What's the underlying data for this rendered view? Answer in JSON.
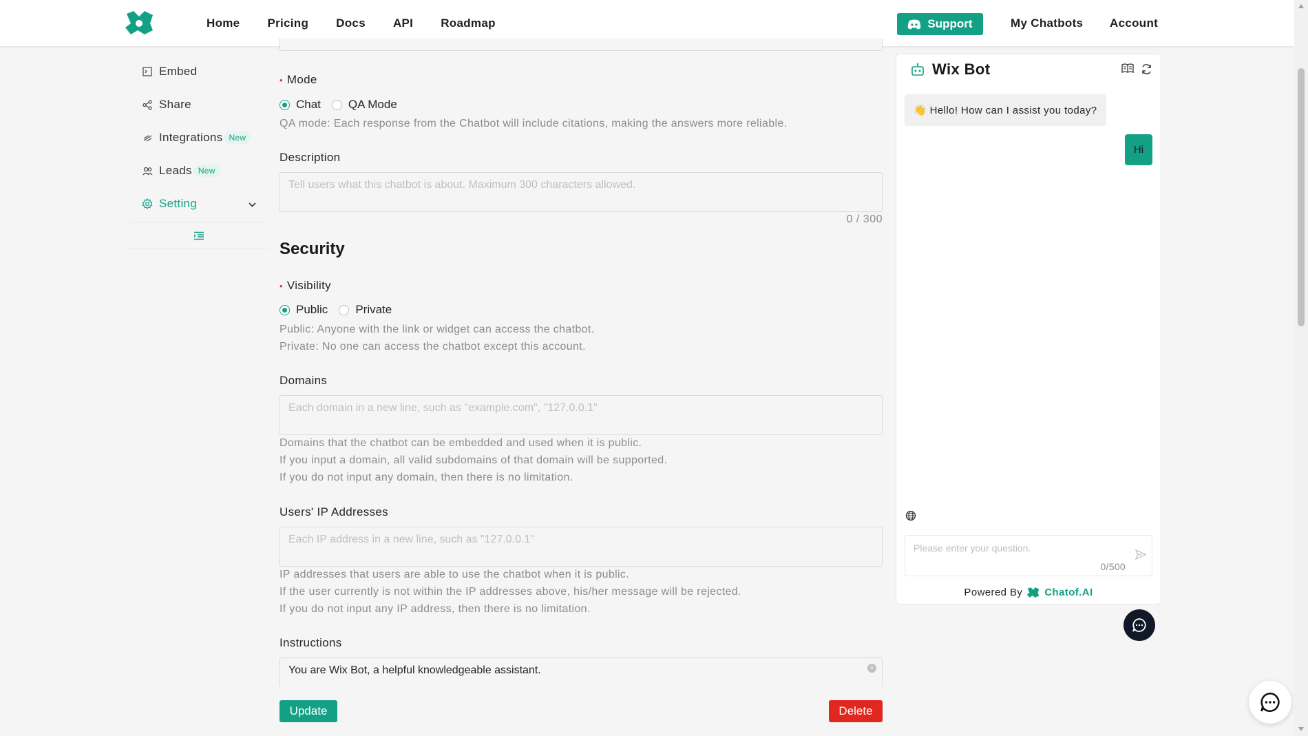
{
  "header": {
    "nav": [
      "Home",
      "Pricing",
      "Docs",
      "API",
      "Roadmap"
    ],
    "support_label": "Support",
    "my_chatbots": "My Chatbots",
    "account": "Account"
  },
  "sidebar": {
    "items": [
      {
        "label": "Embed",
        "icon": "embed-icon"
      },
      {
        "label": "Share",
        "icon": "share-icon"
      },
      {
        "label": "Integrations",
        "icon": "integrations-icon",
        "badge": "New"
      },
      {
        "label": "Leads",
        "icon": "leads-icon",
        "badge": "New"
      },
      {
        "label": "Setting",
        "icon": "gear-icon",
        "active": true
      }
    ]
  },
  "form": {
    "mode_label": "Mode",
    "mode_options": [
      "Chat",
      "QA Mode"
    ],
    "mode_selected": "Chat",
    "mode_help": "QA mode: Each response from the Chatbot will include citations, making the answers more reliable.",
    "description_label": "Description",
    "description_placeholder": "Tell users what this chatbot is about. Maximum 300 characters allowed.",
    "description_count": "0 / 300",
    "security_title": "Security",
    "visibility_label": "Visibility",
    "visibility_options": [
      "Public",
      "Private"
    ],
    "visibility_selected": "Public",
    "visibility_help": [
      "Public: Anyone with the link or widget can access the chatbot.",
      "Private: No one can access the chatbot except this account."
    ],
    "domains_label": "Domains",
    "domains_placeholder": "Each domain in a new line, such as \"example.com\", \"127.0.0.1\"",
    "domains_help": [
      "Domains that the chatbot can be embedded and used when it is public.",
      "If you input a domain, all valid subdomains of that domain will be supported.",
      "If you do not input any domain, then there is no limitation."
    ],
    "ip_label": "Users' IP Addresses",
    "ip_placeholder": "Each IP address in a new line, such as \"127.0.0.1\"",
    "ip_help": [
      "IP addresses that users are able to use the chatbot when it is public.",
      "If the user currently is not within the IP addresses above, his/her message will be rejected.",
      "If you do not input any IP address, then there is no limitation."
    ],
    "instructions_label": "Instructions",
    "instructions_value": "You are Wix Bot, a helpful knowledgeable assistant.",
    "update_label": "Update",
    "delete_label": "Delete"
  },
  "chat": {
    "title": "Wix Bot",
    "greeting": "👋 Hello! How can I assist you today?",
    "user_message": "Hi",
    "input_placeholder": "Please enter your question.",
    "input_count": "0/500",
    "powered_by": "Powered By",
    "brand": "Chatof.AI"
  },
  "colors": {
    "accent": "#14a085",
    "danger": "#e0281f"
  }
}
